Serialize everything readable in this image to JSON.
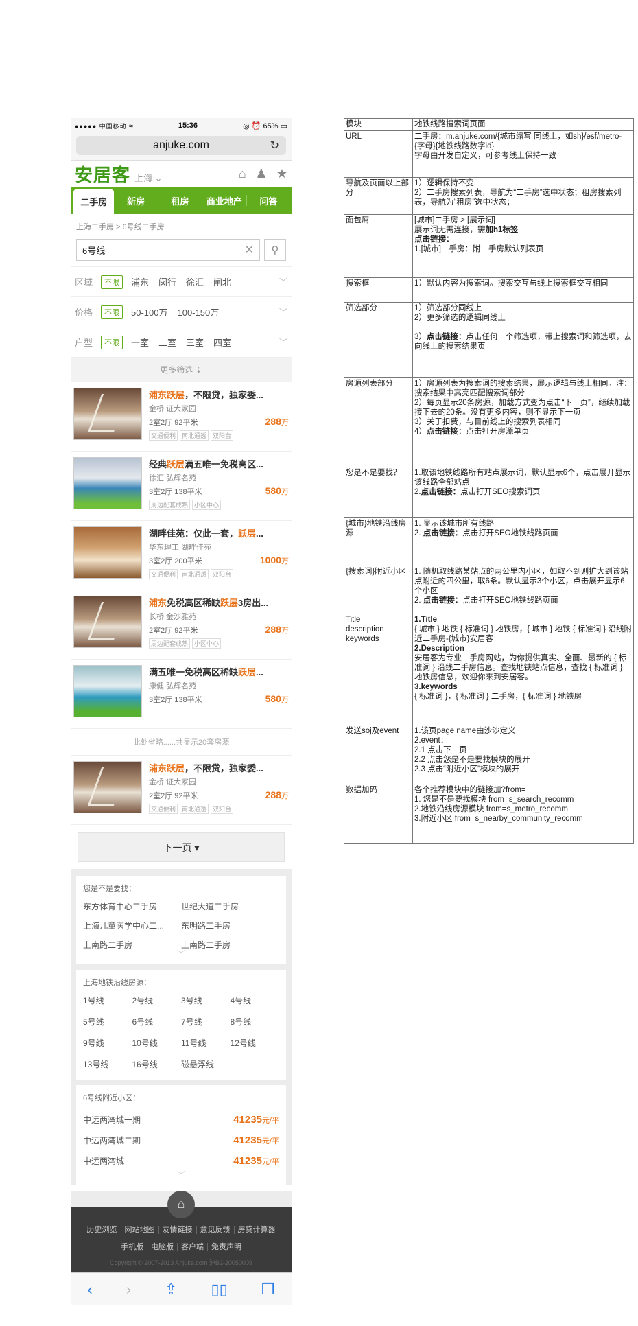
{
  "status_bar": {
    "signal": "●●●●● 中国移动",
    "wifi": "≈",
    "time": "15:36",
    "icons": "◎ ⏰",
    "battery": "65%"
  },
  "browser": {
    "url": "anjuke.com",
    "reload_icon": "reload-icon"
  },
  "site_header": {
    "logo": "安居客",
    "city": "上海",
    "city_arrow": "⌄"
  },
  "nav_tabs": [
    "二手房",
    "新房",
    "租房",
    "商业地产",
    "问答"
  ],
  "breadcrumb": "上海二手房 > 6号线二手房",
  "search": {
    "value": "6号线",
    "clear": "✕",
    "button": "⚲"
  },
  "filters": [
    {
      "label": "区域",
      "tag": "不限",
      "options": [
        "浦东",
        "闵行",
        "徐汇",
        "闸北"
      ]
    },
    {
      "label": "价格",
      "tag": "不限",
      "options": [
        "50-100万",
        "100-150万"
      ]
    },
    {
      "label": "户型",
      "tag": "不限",
      "options": [
        "一室",
        "二室",
        "三室",
        "四室"
      ]
    }
  ],
  "more_filters": "更多筛选 ⇣",
  "listings": [
    {
      "t1": "浦东跃层",
      "t2": "，不限贷，独家委...",
      "t3": "",
      "sub": "金桥  证大家园",
      "spec": "2室2厅   92平米",
      "price": "288",
      "unit": "万",
      "tags": [
        "交通便利",
        "南北通透",
        "双阳台"
      ]
    },
    {
      "t1": "",
      "t2": "经典",
      "t3": "跃层",
      "t4": "满五唯一免税高区...",
      "sub": "徐汇  弘辉名苑",
      "spec": "3室2厅   138平米",
      "price": "580",
      "unit": "万",
      "tags": [
        "周边配套成熟",
        "小区中心"
      ]
    },
    {
      "t1": "",
      "t2": "湖畔佳苑：仅此一套，",
      "t3": "跃层",
      "t4": "...",
      "sub": "华东理工  湖畔佳苑",
      "spec": "3室2厅   200平米",
      "price": "1000",
      "unit": "万",
      "tags": [
        "交通便利",
        "南北通透",
        "双阳台"
      ]
    },
    {
      "t1": "浦东",
      "t2": "免税高区稀缺",
      "t3": "跃层",
      "t4": "3房出...",
      "sub": "长桥  金沙雅苑",
      "spec": "2室2厅   92平米",
      "price": "288",
      "unit": "万",
      "tags": [
        "周边配套成熟",
        "小区中心"
      ]
    },
    {
      "t1": "",
      "t2": "满五唯一免税高区稀缺",
      "t3": "跃层",
      "t4": "...",
      "sub": "康健  弘辉名苑",
      "spec": "3室2厅   138平米",
      "price": "580",
      "unit": "万",
      "tags": []
    }
  ],
  "omit_text": "此处省略......共显示20套房源",
  "last_listing": {
    "t1": "浦东跃层",
    "t2": "，不限贷，独家委...",
    "sub": "金桥  证大家园",
    "spec": "2室2厅   92平米",
    "price": "288",
    "unit": "万",
    "tags": [
      "交通便利",
      "南北通透",
      "双阳台"
    ]
  },
  "next_page": "下一页 ▾",
  "maybe_looking": {
    "title": "您是不是要找：",
    "items": [
      "东方体育中心二手房",
      "世纪大道二手房",
      "上海儿童医学中心二...",
      "东明路二手房",
      "上南路二手房",
      "上南路二手房"
    ],
    "fold": "﹀"
  },
  "metro_lines": {
    "title": "上海地铁沿线房源：",
    "items": [
      "1号线",
      "2号线",
      "3号线",
      "4号线",
      "5号线",
      "6号线",
      "7号线",
      "8号线",
      "9号线",
      "10号线",
      "11号线",
      "12号线",
      "13号线",
      "16号线",
      "磁悬浮线"
    ]
  },
  "nearby": {
    "title": "6号线附近小区：",
    "items": [
      {
        "name": "中远两湾城一期",
        "price": "41235",
        "unit": "元/平"
      },
      {
        "name": "中远两湾城二期",
        "price": "41235",
        "unit": "元/平"
      },
      {
        "name": "中远两湾城",
        "price": "41235",
        "unit": "元/平"
      }
    ],
    "fold": "﹀"
  },
  "footer": {
    "home_icon": "⌂",
    "row1": [
      "历史浏览",
      "网站地图",
      "友情链接",
      "意见反馈",
      "房贷计算器"
    ],
    "row2": [
      "手机版",
      "电脑版",
      "客户端",
      "免责声明"
    ],
    "copyright": "Copyright © 2007-2013 Anjuke.com  沪B2-20050009"
  },
  "safari_toolbar": [
    "‹",
    "›",
    "⇪",
    "▯▯",
    "❐"
  ],
  "spec_table": [
    {
      "key": "模块",
      "val": "地铁线路搜索词页面"
    },
    {
      "key": "URL",
      "val": "二手房：m.anjuke.com/{城市缩写 同线上，如sh}/esf/metro-{字母}{地铁线路数字id}<br>字母由开发自定义，可参考线上保持一致"
    },
    {
      "key": "导航及页面以上部分",
      "val": "1）逻辑保持不变<br>2）二手房搜索列表，导航为“二手房”选中状态；租房搜索列表，导航为“租房”选中状态；"
    },
    {
      "key": "面包屑",
      "val": "[城市]二手房 > [展示词]<br>展示词无需连接，需<b>加h1标签</b><br><b>点击链接：</b><br>1.[城市]二手房：附二手房默认列表页"
    },
    {
      "key": "搜索框",
      "val": "1）默认内容为搜索词。搜索交互与线上搜索框交互相同"
    },
    {
      "key": "筛选部分",
      "val": "1）筛选部分同线上<br>2）更多筛选的逻辑同线上<br><br>3）<b>点击链接</b>：点击任何一个筛选项，带上搜索词和筛选项，去向线上的搜索结果页"
    },
    {
      "key": "房源列表部分",
      "val": "1）房源列表为搜索词的搜索结果，展示逻辑与线上相同。注：搜索结果中高亮匹配搜索词部分<br>2）每页显示20条房源，加载方式变为点击“下一页”，继续加载接下去的20条。没有更多内容，则不显示下一页<br>3）关于扣费，与目前线上的搜索列表相同<br>4）<b>点击链接</b>：点击打开房源单页"
    },
    {
      "key": "您是不是要找？",
      "val": "1.取该地铁线路所有站点展示词，默认显示6个，点击展开显示该线路全部站点<br>2.<b>点击链接：</b>点击打开SEO搜索词页"
    },
    {
      "key": "{城市}地铁沿线房源",
      "val": "1. 显示该城市所有线路<br>2. <b>点击链接：</b>点击打开SEO地铁线路页面"
    },
    {
      "key": "{搜索词}附近小区",
      "val": "1. 随机取线路某站点的两公里内小区，如取不到则扩大到该站点附近的四公里，取6条。默认显示3个小区，点击展开显示6个小区<br>2. <b>点击链接：</b>点击打开SEO地铁线路页面"
    },
    {
      "key": "Title<br>description<br>keywords",
      "val": "<b>1.Title</b><br>{ 城市 } 地铁 { 标准词 } 地铁房，{ 城市 } 地铁 { 标准词 } 沿线附近二手房-{城市}安居客<br><b>2.Description</b><br>安居客为专业二手房网站，为你提供真实、全面、最新的 { 标准词 } 沿线二手房信息。查找地铁站点信息，查找 { 标准词 } 地铁房信息，欢迎你来到安居客。<br><b>3.keywords</b><br>{ 标准词 }，{ 标准词 } 二手房，{ 标准词 } 地铁房"
    },
    {
      "key": "发送soj及event",
      "val": "1.该页page name由沙沙定义<br>2.event：<br>2.1 点击下一页<br>2.2 点击您是不是要找模块的展开<br>2.3 点击“附近小区”模块的展开"
    },
    {
      "key": "数据加码",
      "val": "各个推荐模块中的链接加?from=<br>1. 您是不是要找模块 from=s_search_recomm<br>2.地铁沿线房源模块 from=s_metro_recomm<br>3.附近小区 from=s_nearby_community_recomm"
    }
  ]
}
